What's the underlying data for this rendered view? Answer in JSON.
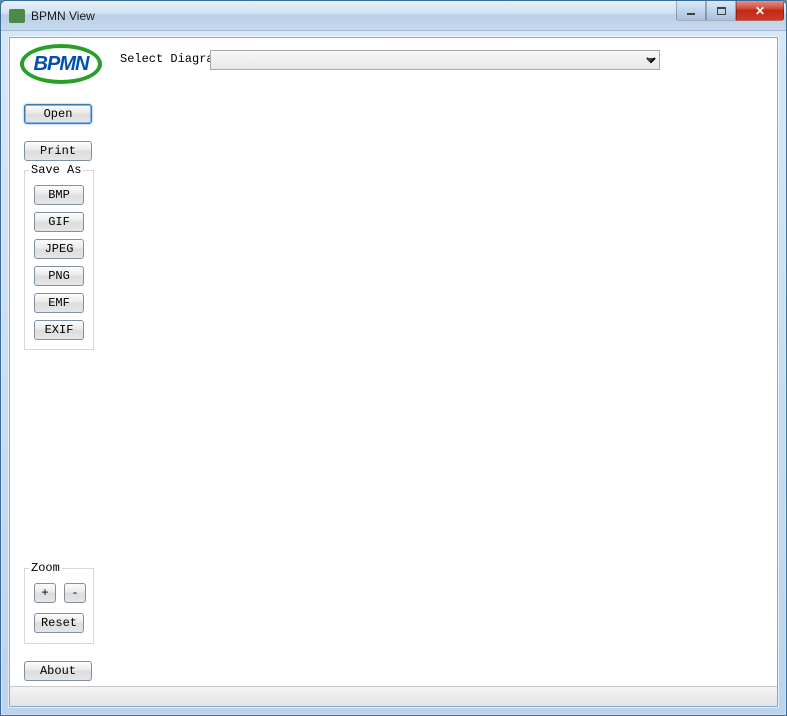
{
  "window": {
    "title": "BPMN View"
  },
  "logo": {
    "text": "BPMN"
  },
  "select": {
    "label": "Select Diagram",
    "value": ""
  },
  "buttons": {
    "open": "Open",
    "print": "Print",
    "about": "About"
  },
  "save_as": {
    "title": "Save As",
    "formats": {
      "bmp": "BMP",
      "gif": "GIF",
      "jpeg": "JPEG",
      "png": "PNG",
      "emf": "EMF",
      "exif": "EXIF"
    }
  },
  "zoom": {
    "title": "Zoom",
    "in": "+",
    "out": "-",
    "reset": "Reset"
  }
}
